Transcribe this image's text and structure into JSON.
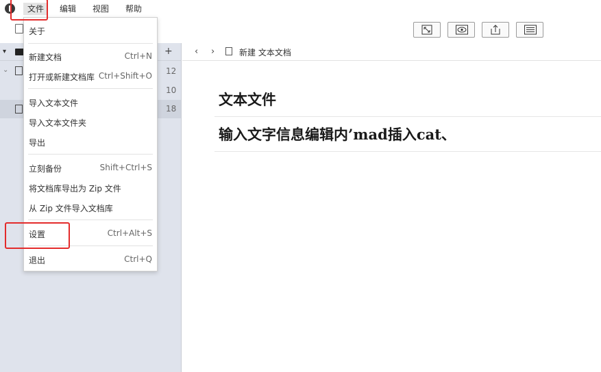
{
  "menubar": {
    "items": [
      {
        "label": "文件"
      },
      {
        "label": "编辑"
      },
      {
        "label": "视图"
      },
      {
        "label": "帮助"
      }
    ]
  },
  "toolbar": {
    "buttons": [
      {
        "icon": "expand-icon"
      },
      {
        "icon": "eye-icon"
      },
      {
        "icon": "share-icon"
      },
      {
        "icon": "outline-icon"
      }
    ]
  },
  "sidebar": {
    "add_label": "+",
    "counts": [
      "12",
      "10",
      "18"
    ]
  },
  "breadcrumb": {
    "back": "‹",
    "forward": "›",
    "title": "新建 文本文档"
  },
  "editor": {
    "lines": [
      "文本文件",
      "输入文字信息编辑内’mad插入cat、"
    ]
  },
  "file_menu": {
    "items": [
      {
        "label": "关于",
        "shortcut": ""
      },
      {
        "label": "新建文档",
        "shortcut": "Ctrl+N"
      },
      {
        "label": "打开或新建文档库",
        "shortcut": "Ctrl+Shift+O"
      },
      {
        "label": "导入文本文件",
        "shortcut": ""
      },
      {
        "label": "导入文本文件夹",
        "shortcut": ""
      },
      {
        "label": "导出",
        "shortcut": ""
      },
      {
        "label": "立刻备份",
        "shortcut": "Shift+Ctrl+S"
      },
      {
        "label": "将文档库导出为 Zip 文件",
        "shortcut": ""
      },
      {
        "label": "从 Zip 文件导入文档库",
        "shortcut": ""
      },
      {
        "label": "设置",
        "shortcut": "Ctrl+Alt+S"
      },
      {
        "label": "退出",
        "shortcut": "Ctrl+Q"
      }
    ]
  },
  "colors": {
    "highlight": "#e32a2a",
    "sidebar_bg": "#dfe3ec"
  }
}
